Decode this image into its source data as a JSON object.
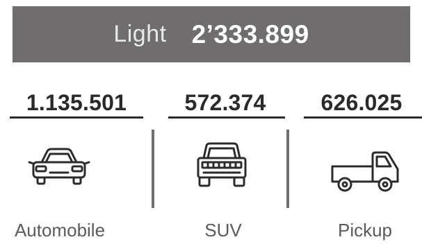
{
  "banner": {
    "label": "Light",
    "value": "2’333.899"
  },
  "categories": [
    {
      "value": "1.135.501",
      "label": "Automobile",
      "icon": "car-icon"
    },
    {
      "value": "572.374",
      "label": "SUV",
      "icon": "suv-icon"
    },
    {
      "value": "626.025",
      "label": "Pickup",
      "icon": "pickup-truck-icon"
    }
  ],
  "colors": {
    "banner_background": "#6f6d6e",
    "banner_text": "#ffffff",
    "numbers": "#2a2a2a",
    "captions": "#5a5a5a",
    "dividers": "#6f6d6e"
  }
}
